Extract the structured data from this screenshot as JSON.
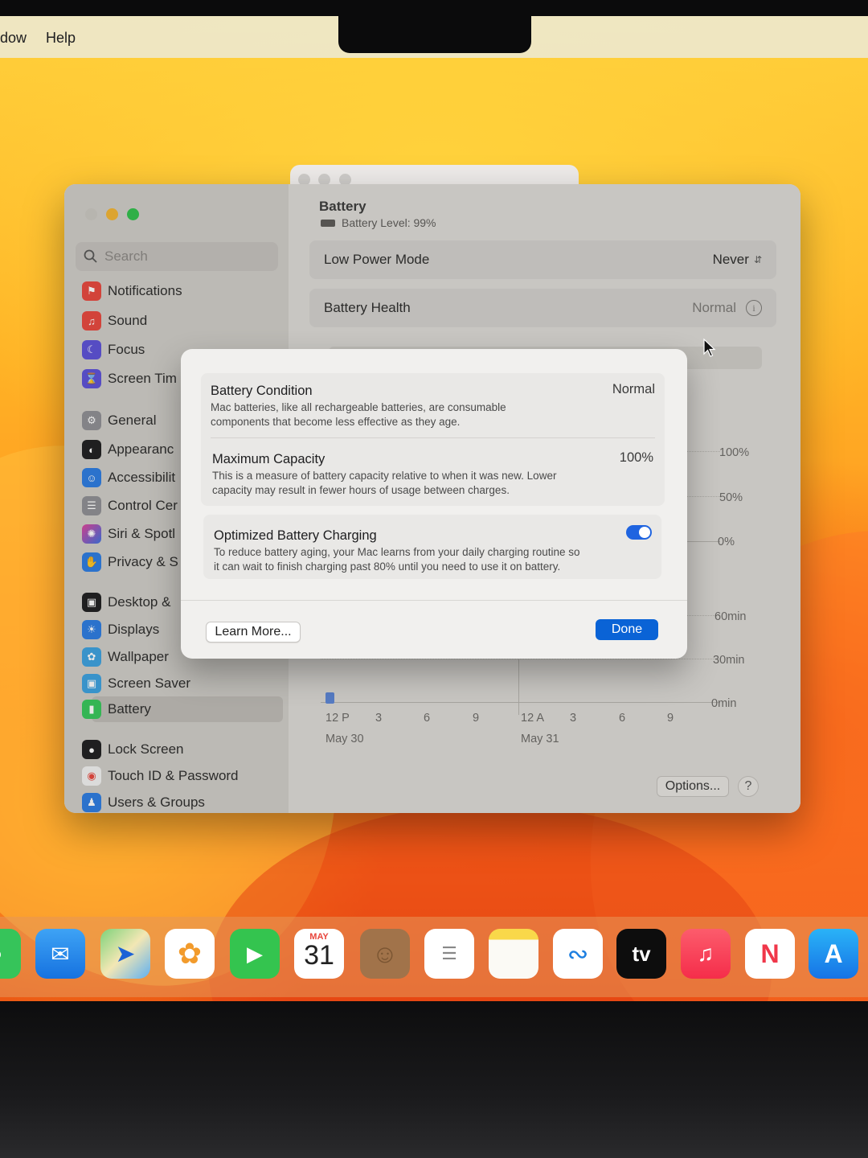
{
  "menubar": {
    "items": [
      "dow",
      "Help"
    ]
  },
  "window": {
    "sidebar": {
      "search_placeholder": "Search",
      "items": [
        {
          "label": "Notifications",
          "icon": "bell-icon",
          "color": "#e8453c"
        },
        {
          "label": "Sound",
          "icon": "speaker-icon",
          "color": "#e8453c"
        },
        {
          "label": "Focus",
          "icon": "moon-icon",
          "color": "#5b4fd8"
        },
        {
          "label": "Screen Tim",
          "icon": "hourglass-icon",
          "color": "#5b4fd8"
        },
        {
          "label": "General",
          "icon": "gear-icon",
          "color": "#8e8e93"
        },
        {
          "label": "Appearanc",
          "icon": "appearance-icon",
          "color": "#1c1c1e"
        },
        {
          "label": "Accessibilit",
          "icon": "accessibility-icon",
          "color": "#2a7ae2"
        },
        {
          "label": "Control Cer",
          "icon": "switches-icon",
          "color": "#8e8e93"
        },
        {
          "label": "Siri & Spotl",
          "icon": "siri-icon",
          "color": "#6e3fd8"
        },
        {
          "label": "Privacy & S",
          "icon": "hand-icon",
          "color": "#2a7ae2"
        },
        {
          "label": "Desktop &",
          "icon": "desktop-icon",
          "color": "#1c1c1e"
        },
        {
          "label": "Displays",
          "icon": "sun-icon",
          "color": "#2a7ae2"
        },
        {
          "label": "Wallpaper",
          "icon": "flower-icon",
          "color": "#3aa0e0"
        },
        {
          "label": "Screen Saver",
          "icon": "screensaver-icon",
          "color": "#3aa0e0"
        },
        {
          "label": "Battery",
          "icon": "battery-icon",
          "color": "#34c759"
        },
        {
          "label": "Lock Screen",
          "icon": "lock-icon",
          "color": "#1c1c1e"
        },
        {
          "label": "Touch ID & Password",
          "icon": "fingerprint-icon",
          "color": "#f2f2f2"
        },
        {
          "label": "Users & Groups",
          "icon": "users-icon",
          "color": "#2a7ae2"
        }
      ]
    },
    "header": {
      "title": "Battery",
      "subtitle": "Battery Level: 99%"
    },
    "rows": {
      "low_power_label": "Low Power Mode",
      "low_power_value": "Never",
      "health_label": "Battery Health",
      "health_value": "Normal"
    },
    "chart": {
      "pct_ticks": [
        "100%",
        "50%",
        "0%"
      ],
      "min_ticks": [
        "60min",
        "30min",
        "0min"
      ],
      "x_ticks": [
        "12 P",
        "3",
        "6",
        "9",
        "12 A",
        "3",
        "6",
        "9"
      ],
      "dates": [
        "May 30",
        "May 31"
      ]
    },
    "options_label": "Options...",
    "help_label": "?"
  },
  "dialog": {
    "condition_title": "Battery Condition",
    "condition_value": "Normal",
    "condition_desc_1": "Mac batteries, like all rechargeable batteries, are consumable",
    "condition_desc_2": "components that become less effective as they age.",
    "capacity_title": "Maximum Capacity",
    "capacity_value": "100%",
    "capacity_desc_1": "This is a measure of battery capacity relative to when it was new. Lower",
    "capacity_desc_2": "capacity may result in fewer hours of usage between charges.",
    "charging_title": "Optimized Battery Charging",
    "charging_enabled": true,
    "charging_desc_1": "To reduce battery aging, your Mac learns from your daily charging routine so",
    "charging_desc_2": "it can wait to finish charging past 80% until you need to use it on battery.",
    "learn_more_label": "Learn More...",
    "done_label": "Done"
  },
  "dock": {
    "calendar_month": "MAY",
    "calendar_day": "31",
    "tv_label": "tv",
    "apps": [
      "messages-icon",
      "mail-icon",
      "maps-icon",
      "photos-icon",
      "facetime-icon",
      "calendar-icon",
      "contacts-icon",
      "reminders-icon",
      "notes-icon",
      "freeform-icon",
      "appletv-icon",
      "music-icon",
      "news-icon",
      "appstore-icon"
    ]
  },
  "colors": {
    "accent": "#0a63d6",
    "toggle_on": "#1f64e0"
  }
}
